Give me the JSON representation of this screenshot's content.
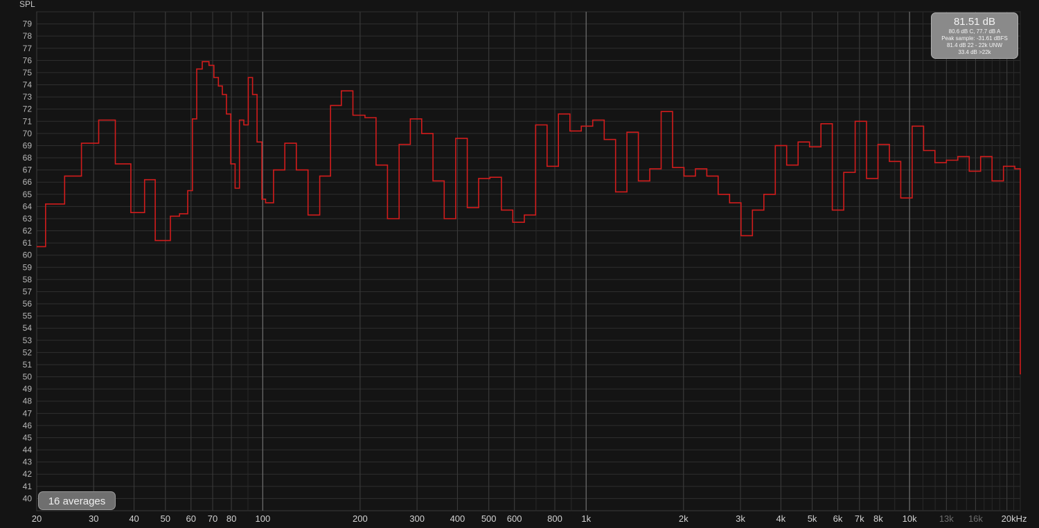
{
  "overlay": {
    "total": "81.51 dB",
    "line1": "80.6 dB C, 77.7 dB A",
    "line2": "Peak sample: -31.61 dBFS",
    "line3": "81.4 dB 22 - 22k UNW",
    "line4": "33.4 dB >22k"
  },
  "averages_label": "16 averages",
  "colors": {
    "background": "#141414",
    "trace": "#d21c1c"
  },
  "chart_data": {
    "type": "line",
    "step": true,
    "scale_x": "log",
    "ylabel": "SPL",
    "xlim": [
      20,
      22000
    ],
    "ylim": [
      39,
      80
    ],
    "x_ticks": [
      "20",
      "30",
      "40",
      "50",
      "60",
      "70",
      "80",
      "100",
      "200",
      "300",
      "400",
      "500",
      "600",
      "800",
      "1k",
      "2k",
      "3k",
      "4k",
      "5k",
      "6k",
      "7k",
      "8k",
      "10k",
      "13k",
      "16k",
      "20kHz"
    ],
    "x_tick_values": [
      20,
      30,
      40,
      50,
      60,
      70,
      80,
      100,
      200,
      300,
      400,
      500,
      600,
      800,
      1000,
      2000,
      3000,
      4000,
      5000,
      6000,
      7000,
      8000,
      10000,
      13000,
      16000,
      20000
    ],
    "x_tick_dim": [
      "13k",
      "16k"
    ],
    "y_ticks": [
      40,
      41,
      42,
      43,
      44,
      45,
      46,
      47,
      48,
      49,
      50,
      51,
      52,
      53,
      54,
      55,
      56,
      57,
      58,
      59,
      60,
      61,
      62,
      63,
      64,
      65,
      66,
      67,
      68,
      69,
      70,
      71,
      72,
      73,
      74,
      75,
      76,
      77,
      78,
      79
    ],
    "bins": [
      {
        "x0": 20,
        "x1": 21.3,
        "y": 60.7
      },
      {
        "x0": 21.3,
        "x1": 24.4,
        "y": 64.2
      },
      {
        "x0": 24.4,
        "x1": 27.5,
        "y": 66.5
      },
      {
        "x0": 27.5,
        "x1": 31.1,
        "y": 69.2
      },
      {
        "x0": 31.1,
        "x1": 35.0,
        "y": 71.1
      },
      {
        "x0": 35.0,
        "x1": 39.1,
        "y": 67.5
      },
      {
        "x0": 39.1,
        "x1": 43.1,
        "y": 63.5
      },
      {
        "x0": 43.1,
        "x1": 46.5,
        "y": 66.2
      },
      {
        "x0": 46.5,
        "x1": 51.8,
        "y": 61.2
      },
      {
        "x0": 51.8,
        "x1": 55.3,
        "y": 63.2
      },
      {
        "x0": 55.3,
        "x1": 58.1,
        "y": 63.4
      },
      {
        "x0": 58.1,
        "x1": 58.6,
        "y": 63.4
      },
      {
        "x0": 58.6,
        "x1": 60.6,
        "y": 65.3
      },
      {
        "x0": 60.6,
        "x1": 62.5,
        "y": 71.2
      },
      {
        "x0": 62.5,
        "x1": 65.0,
        "y": 75.3
      },
      {
        "x0": 65.0,
        "x1": 68.2,
        "y": 75.9
      },
      {
        "x0": 68.2,
        "x1": 70.6,
        "y": 75.6
      },
      {
        "x0": 70.6,
        "x1": 72.9,
        "y": 74.6
      },
      {
        "x0": 72.9,
        "x1": 75.0,
        "y": 73.9
      },
      {
        "x0": 75.0,
        "x1": 77.2,
        "y": 73.2
      },
      {
        "x0": 77.2,
        "x1": 79.6,
        "y": 71.6
      },
      {
        "x0": 79.6,
        "x1": 82.1,
        "y": 67.5
      },
      {
        "x0": 82.1,
        "x1": 84.7,
        "y": 65.5
      },
      {
        "x0": 84.7,
        "x1": 87.4,
        "y": 71.1
      },
      {
        "x0": 87.4,
        "x1": 90.2,
        "y": 70.7
      },
      {
        "x0": 90.2,
        "x1": 93.0,
        "y": 74.6
      },
      {
        "x0": 93.0,
        "x1": 96.0,
        "y": 73.2
      },
      {
        "x0": 96.0,
        "x1": 99.4,
        "y": 69.3
      },
      {
        "x0": 99.4,
        "x1": 102.0,
        "y": 64.6
      },
      {
        "x0": 102.0,
        "x1": 108.0,
        "y": 64.3
      },
      {
        "x0": 108.0,
        "x1": 117.0,
        "y": 67.0
      },
      {
        "x0": 117.0,
        "x1": 127.0,
        "y": 69.2
      },
      {
        "x0": 127.0,
        "x1": 138.0,
        "y": 67.0
      },
      {
        "x0": 138.0,
        "x1": 150.0,
        "y": 63.3
      },
      {
        "x0": 150.0,
        "x1": 162.0,
        "y": 66.5
      },
      {
        "x0": 162.0,
        "x1": 175.0,
        "y": 72.3
      },
      {
        "x0": 175.0,
        "x1": 190.0,
        "y": 73.5
      },
      {
        "x0": 190.0,
        "x1": 207.0,
        "y": 71.5
      },
      {
        "x0": 207.0,
        "x1": 224.0,
        "y": 71.3
      },
      {
        "x0": 224.0,
        "x1": 243.0,
        "y": 67.4
      },
      {
        "x0": 243.0,
        "x1": 264.0,
        "y": 63.0
      },
      {
        "x0": 264.0,
        "x1": 286.0,
        "y": 69.1
      },
      {
        "x0": 286.0,
        "x1": 310.0,
        "y": 71.2
      },
      {
        "x0": 310.0,
        "x1": 336.0,
        "y": 70.0
      },
      {
        "x0": 336.0,
        "x1": 364.0,
        "y": 66.1
      },
      {
        "x0": 364.0,
        "x1": 395.0,
        "y": 63.0
      },
      {
        "x0": 395.0,
        "x1": 429.0,
        "y": 69.6
      },
      {
        "x0": 429.0,
        "x1": 465.0,
        "y": 63.9
      },
      {
        "x0": 465.0,
        "x1": 504.0,
        "y": 66.3
      },
      {
        "x0": 504.0,
        "x1": 547.0,
        "y": 66.4
      },
      {
        "x0": 547.0,
        "x1": 593.0,
        "y": 63.7
      },
      {
        "x0": 593.0,
        "x1": 644.0,
        "y": 62.7
      },
      {
        "x0": 644.0,
        "x1": 698.0,
        "y": 63.3
      },
      {
        "x0": 698.0,
        "x1": 757.0,
        "y": 70.7
      },
      {
        "x0": 757.0,
        "x1": 821.0,
        "y": 67.3
      },
      {
        "x0": 821.0,
        "x1": 891.0,
        "y": 71.6
      },
      {
        "x0": 891.0,
        "x1": 966.0,
        "y": 70.2
      },
      {
        "x0": 966.0,
        "x1": 1048.0,
        "y": 70.6
      },
      {
        "x0": 1048.0,
        "x1": 1137.0,
        "y": 71.1
      },
      {
        "x0": 1137.0,
        "x1": 1233.0,
        "y": 69.5
      },
      {
        "x0": 1233.0,
        "x1": 1337.0,
        "y": 65.2
      },
      {
        "x0": 1337.0,
        "x1": 1450.0,
        "y": 70.1
      },
      {
        "x0": 1450.0,
        "x1": 1573.0,
        "y": 66.1
      },
      {
        "x0": 1573.0,
        "x1": 1706.0,
        "y": 67.1
      },
      {
        "x0": 1706.0,
        "x1": 1850.0,
        "y": 71.8
      },
      {
        "x0": 1850.0,
        "x1": 2007.0,
        "y": 67.2
      },
      {
        "x0": 2007.0,
        "x1": 2177.0,
        "y": 66.5
      },
      {
        "x0": 2177.0,
        "x1": 2361.0,
        "y": 67.1
      },
      {
        "x0": 2361.0,
        "x1": 2560.0,
        "y": 66.5
      },
      {
        "x0": 2560.0,
        "x1": 2777.0,
        "y": 65.0
      },
      {
        "x0": 2777.0,
        "x1": 3012.0,
        "y": 64.3
      },
      {
        "x0": 3012.0,
        "x1": 3267.0,
        "y": 61.6
      },
      {
        "x0": 3267.0,
        "x1": 3544.0,
        "y": 63.7
      },
      {
        "x0": 3544.0,
        "x1": 3844.0,
        "y": 65.0
      },
      {
        "x0": 3844.0,
        "x1": 4169.0,
        "y": 69.0
      },
      {
        "x0": 4169.0,
        "x1": 4522.0,
        "y": 67.4
      },
      {
        "x0": 4522.0,
        "x1": 4905.0,
        "y": 69.3
      },
      {
        "x0": 4905.0,
        "x1": 5320.0,
        "y": 68.9
      },
      {
        "x0": 5320.0,
        "x1": 5770.0,
        "y": 70.8
      },
      {
        "x0": 5770.0,
        "x1": 6258.0,
        "y": 63.7
      },
      {
        "x0": 6258.0,
        "x1": 6788.0,
        "y": 66.8
      },
      {
        "x0": 6788.0,
        "x1": 7362.0,
        "y": 71.0
      },
      {
        "x0": 7362.0,
        "x1": 7985.0,
        "y": 66.3
      },
      {
        "x0": 7985.0,
        "x1": 8660.0,
        "y": 69.1
      },
      {
        "x0": 8660.0,
        "x1": 9393.0,
        "y": 67.7
      },
      {
        "x0": 9393.0,
        "x1": 10188.0,
        "y": 64.7
      },
      {
        "x0": 10188.0,
        "x1": 11050.0,
        "y": 70.6
      },
      {
        "x0": 11050.0,
        "x1": 11985.0,
        "y": 68.6
      },
      {
        "x0": 11985.0,
        "x1": 12999.0,
        "y": 67.6
      },
      {
        "x0": 12999.0,
        "x1": 14099.0,
        "y": 67.8
      },
      {
        "x0": 14099.0,
        "x1": 15292.0,
        "y": 68.1
      },
      {
        "x0": 15292.0,
        "x1": 16586.0,
        "y": 66.9
      },
      {
        "x0": 16586.0,
        "x1": 17990.0,
        "y": 68.1
      },
      {
        "x0": 17990.0,
        "x1": 19512.0,
        "y": 66.1
      },
      {
        "x0": 19512.0,
        "x1": 21163.0,
        "y": 67.3
      },
      {
        "x0": 21163.0,
        "x1": 22000.0,
        "y": 67.1
      }
    ]
  }
}
